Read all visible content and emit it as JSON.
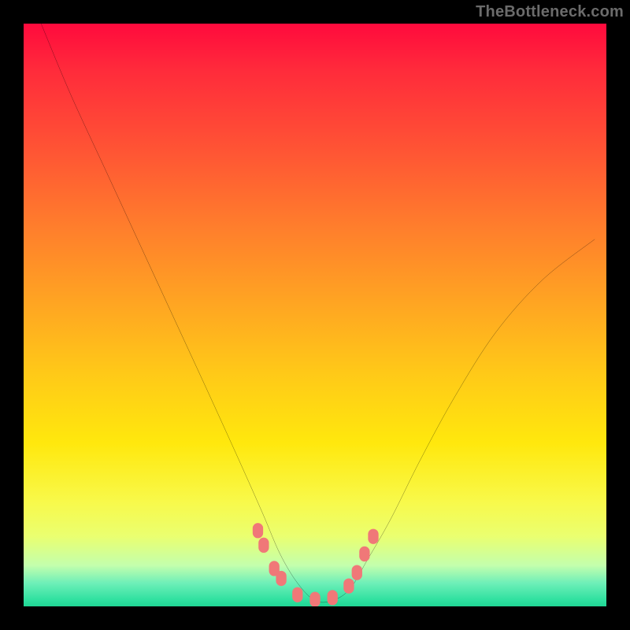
{
  "watermark": "TheBottleneck.com",
  "chart_data": {
    "type": "line",
    "title": "",
    "xlabel": "",
    "ylabel": "",
    "xlim": [
      0,
      100
    ],
    "ylim": [
      0,
      100
    ],
    "grid": false,
    "legend": false,
    "background_gradient": {
      "direction": "top-to-bottom",
      "stops": [
        {
          "pct": 0,
          "color": "#ff0a3d"
        },
        {
          "pct": 22,
          "color": "#ff5534"
        },
        {
          "pct": 48,
          "color": "#ffa522"
        },
        {
          "pct": 72,
          "color": "#ffe80d"
        },
        {
          "pct": 88,
          "color": "#eaff70"
        },
        {
          "pct": 96,
          "color": "#6eefb8"
        },
        {
          "pct": 100,
          "color": "#20d694"
        }
      ]
    },
    "series": [
      {
        "name": "bottleneck-curve",
        "color": "#000000",
        "x": [
          3,
          8,
          14,
          20,
          26,
          32,
          37,
          41,
          44,
          47,
          50,
          53,
          56,
          59,
          63,
          68,
          74,
          81,
          89,
          98
        ],
        "y": [
          100,
          88,
          75,
          62,
          49,
          36,
          25,
          16,
          9,
          4,
          1,
          1,
          3,
          8,
          15,
          25,
          36,
          47,
          56,
          63
        ]
      }
    ],
    "markers": [
      {
        "name": "range-dots",
        "color": "#f07878",
        "shape": "rounded-rect",
        "x": [
          40.2,
          41.2,
          43.0,
          44.2,
          47.0,
          50.0,
          53.0,
          55.8,
          57.2,
          58.5,
          60.0
        ],
        "y": [
          13.0,
          10.5,
          6.5,
          4.8,
          2.0,
          1.2,
          1.5,
          3.5,
          5.8,
          9.0,
          12.0
        ]
      }
    ]
  }
}
